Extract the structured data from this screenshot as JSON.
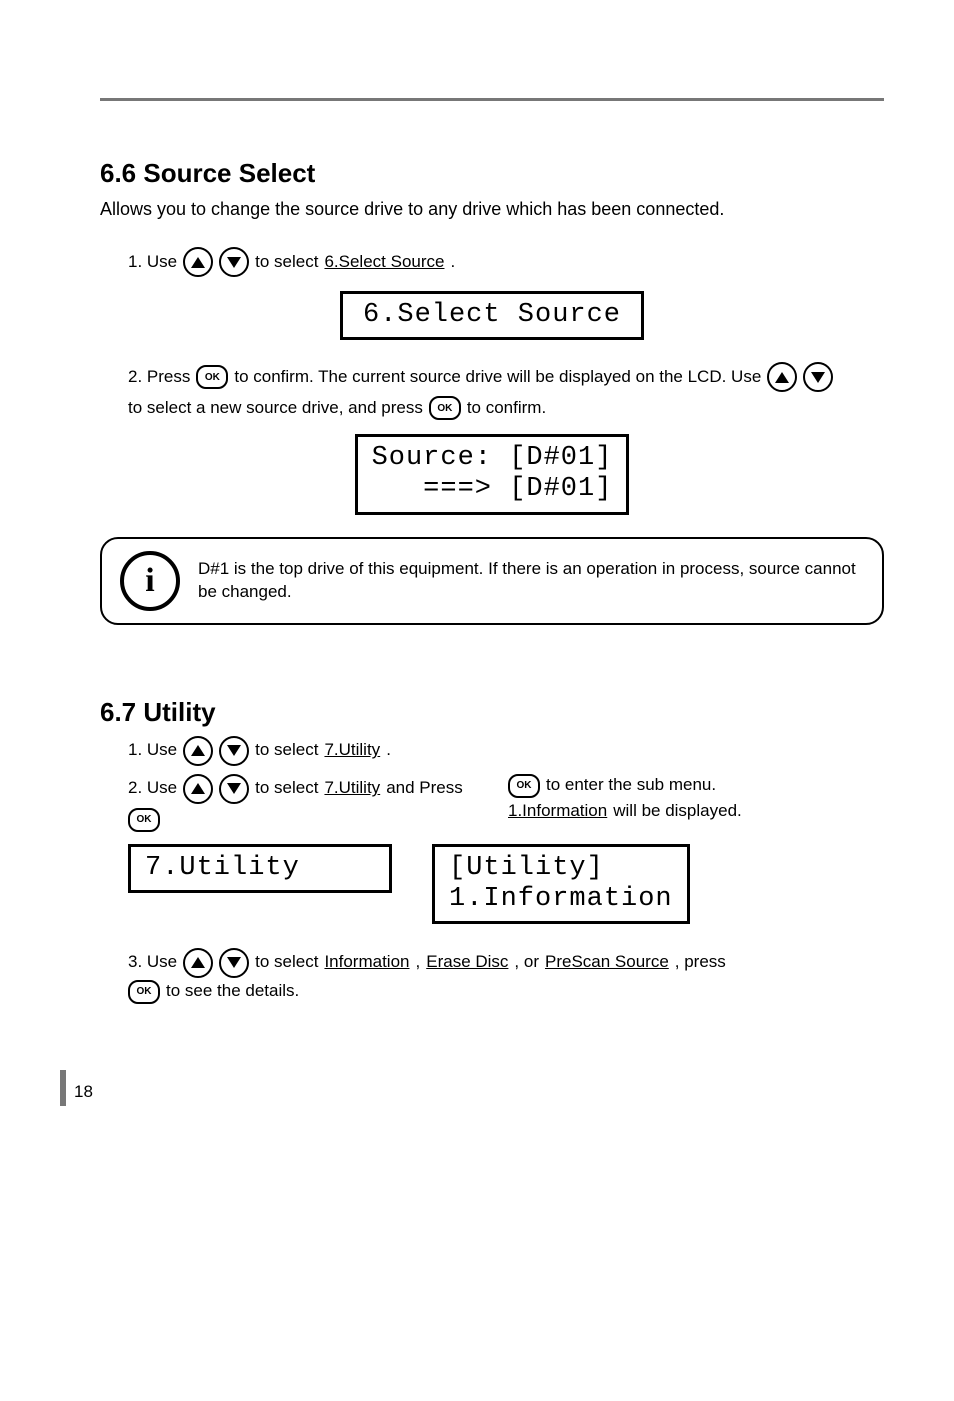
{
  "section_a": {
    "title": "6.6 Source Select",
    "subtitle": "Allows you to change the source drive to any drive which has been connected.",
    "step1_pre": "1. Use ",
    "step1_mid": " to select ",
    "step1_link": "6.Select Source",
    "step1_end": ".",
    "lcd1": "6.Select Source",
    "step2_a": "2. Press ",
    "step2_b": " to confirm. The current source drive will be displayed on the LCD. Use ",
    "step2_c": " to select a new source drive, and press ",
    "step2_d": " to confirm.",
    "lcd2": "Source: [D#01]\n   ===> [D#01]",
    "info": "D#1 is the top drive of this equipment. If there is an operation in process, source cannot be changed.",
    "ok": "OK"
  },
  "section_b": {
    "title": "6.7 Utility",
    "step1_pre": "1. Use ",
    "step1_mid": " to select  ",
    "step1_link": "7.Utility",
    "step1_end": ".",
    "left_col_a": "2. Use ",
    "left_col_b": " to select ",
    "left_col_link": "7.Utility",
    "left_col_c": " and Press ",
    "left_col_d": " to enter the sub menu.",
    "right_col_link": "1.Information",
    "lcd_left": "7.Utility",
    "lcd_right": "[Utility]\n1.Information",
    "step3_a": "3. Use ",
    "step3_b": " to select ",
    "step3_link1": "Information",
    "step3_mid": ", ",
    "step3_link2": "Erase Disc",
    "step3_mid2": ", or ",
    "step3_link3": "PreScan Source",
    "step3_end": ", press ",
    "step3_end2": " to see the details.",
    "ok": "OK"
  },
  "page_number": "18"
}
